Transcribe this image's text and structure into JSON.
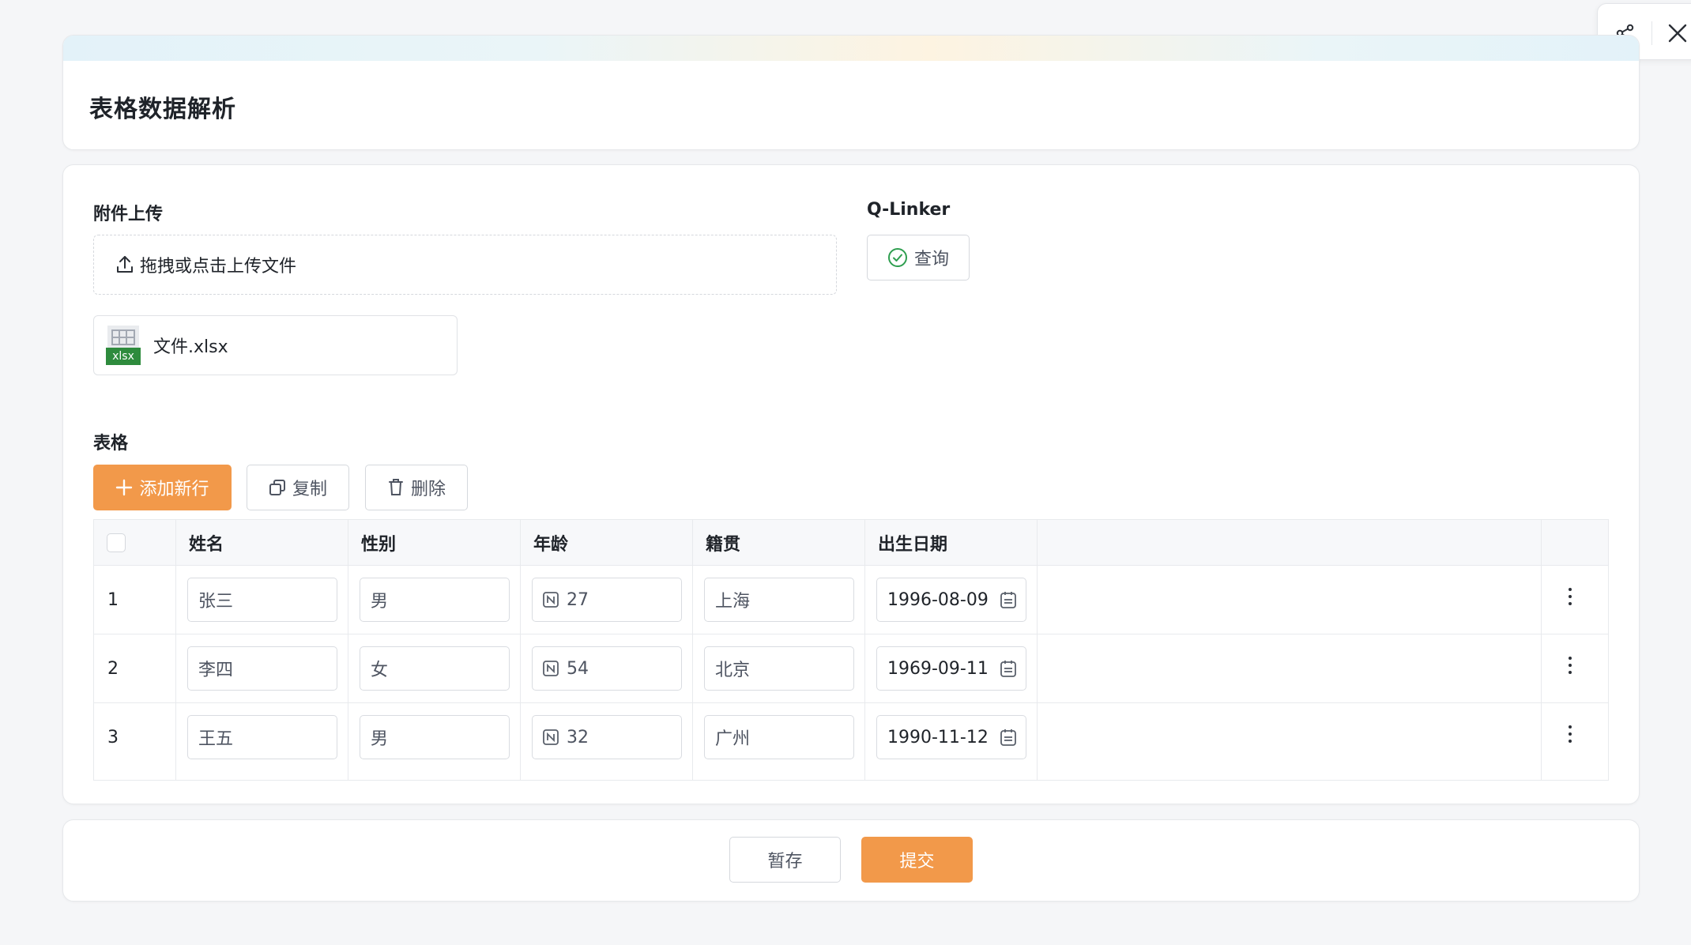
{
  "page": {
    "title": "表格数据解析"
  },
  "toolbar": {
    "share_icon": "share-icon",
    "close_icon": "close-icon"
  },
  "upload": {
    "label": "附件上传",
    "placeholder": "拖拽或点击上传文件",
    "file": {
      "name": "文件.xlsx",
      "badge": "xlsx"
    }
  },
  "qlinker": {
    "label": "Q-Linker",
    "query_button": "查询"
  },
  "table_section": {
    "label": "表格",
    "add_button": "添加新行",
    "copy_button": "复制",
    "delete_button": "删除",
    "columns": [
      "姓名",
      "性别",
      "年龄",
      "籍贯",
      "出生日期"
    ],
    "rows": [
      {
        "index": "1",
        "name": "张三",
        "gender": "男",
        "age": "27",
        "hometown": "上海",
        "birthdate": "1996-08-09"
      },
      {
        "index": "2",
        "name": "李四",
        "gender": "女",
        "age": "54",
        "hometown": "北京",
        "birthdate": "1969-09-11"
      },
      {
        "index": "3",
        "name": "王五",
        "gender": "男",
        "age": "32",
        "hometown": "广州",
        "birthdate": "1990-11-12"
      }
    ]
  },
  "footer": {
    "save_draft": "暂存",
    "submit": "提交"
  },
  "colors": {
    "accent": "#f2994a",
    "excel_green": "#2e8b3d"
  }
}
